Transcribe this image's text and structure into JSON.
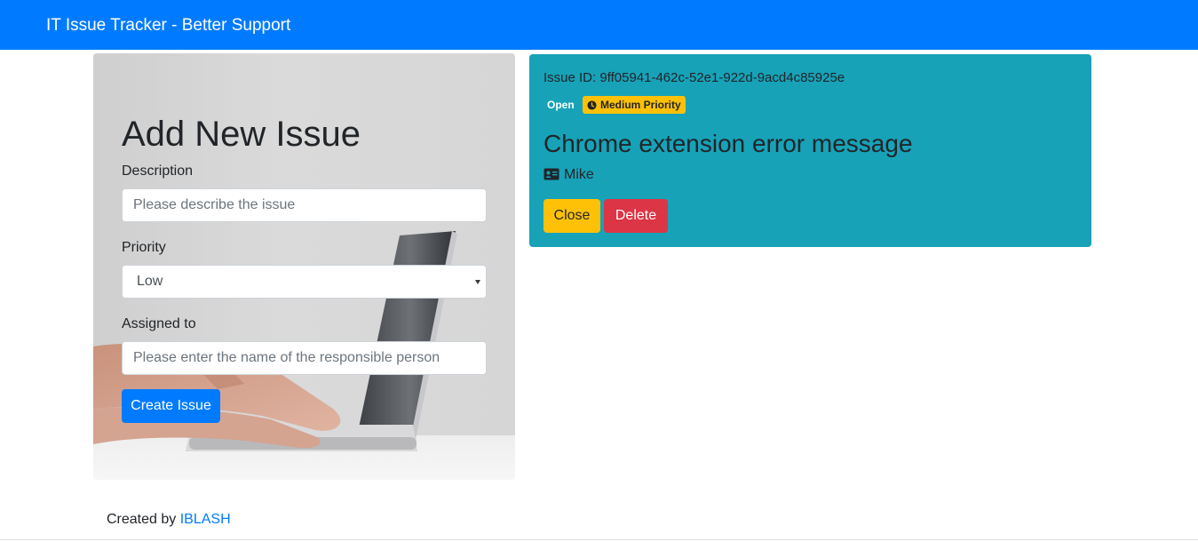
{
  "navbar": {
    "brand": "IT Issue Tracker - Better Support",
    "color": "#007bff"
  },
  "form": {
    "title": "Add New Issue",
    "description_label": "Description",
    "description_placeholder": "Please describe the issue",
    "priority_label": "Priority",
    "priority_value": "Low",
    "priority_options": [
      "Low"
    ],
    "assigned_label": "Assigned to",
    "assigned_placeholder": "Please enter the name of the responsible person",
    "submit_label": "Create Issue"
  },
  "issue": {
    "id_text": "Issue ID: 9ff05941-462c-52e1-922d-9acd4c85925e",
    "status": "Open",
    "priority": "Medium Priority",
    "priority_icon": "clock-icon",
    "title": "Chrome extension error message",
    "assignee_icon": "id-card-icon",
    "assignee": "Mike",
    "close_label": "Close",
    "delete_label": "Delete",
    "card_color": "#17a2b8"
  },
  "footer": {
    "prefix": "Created by ",
    "author": "IBLASH",
    "link_color": "#007bff"
  }
}
